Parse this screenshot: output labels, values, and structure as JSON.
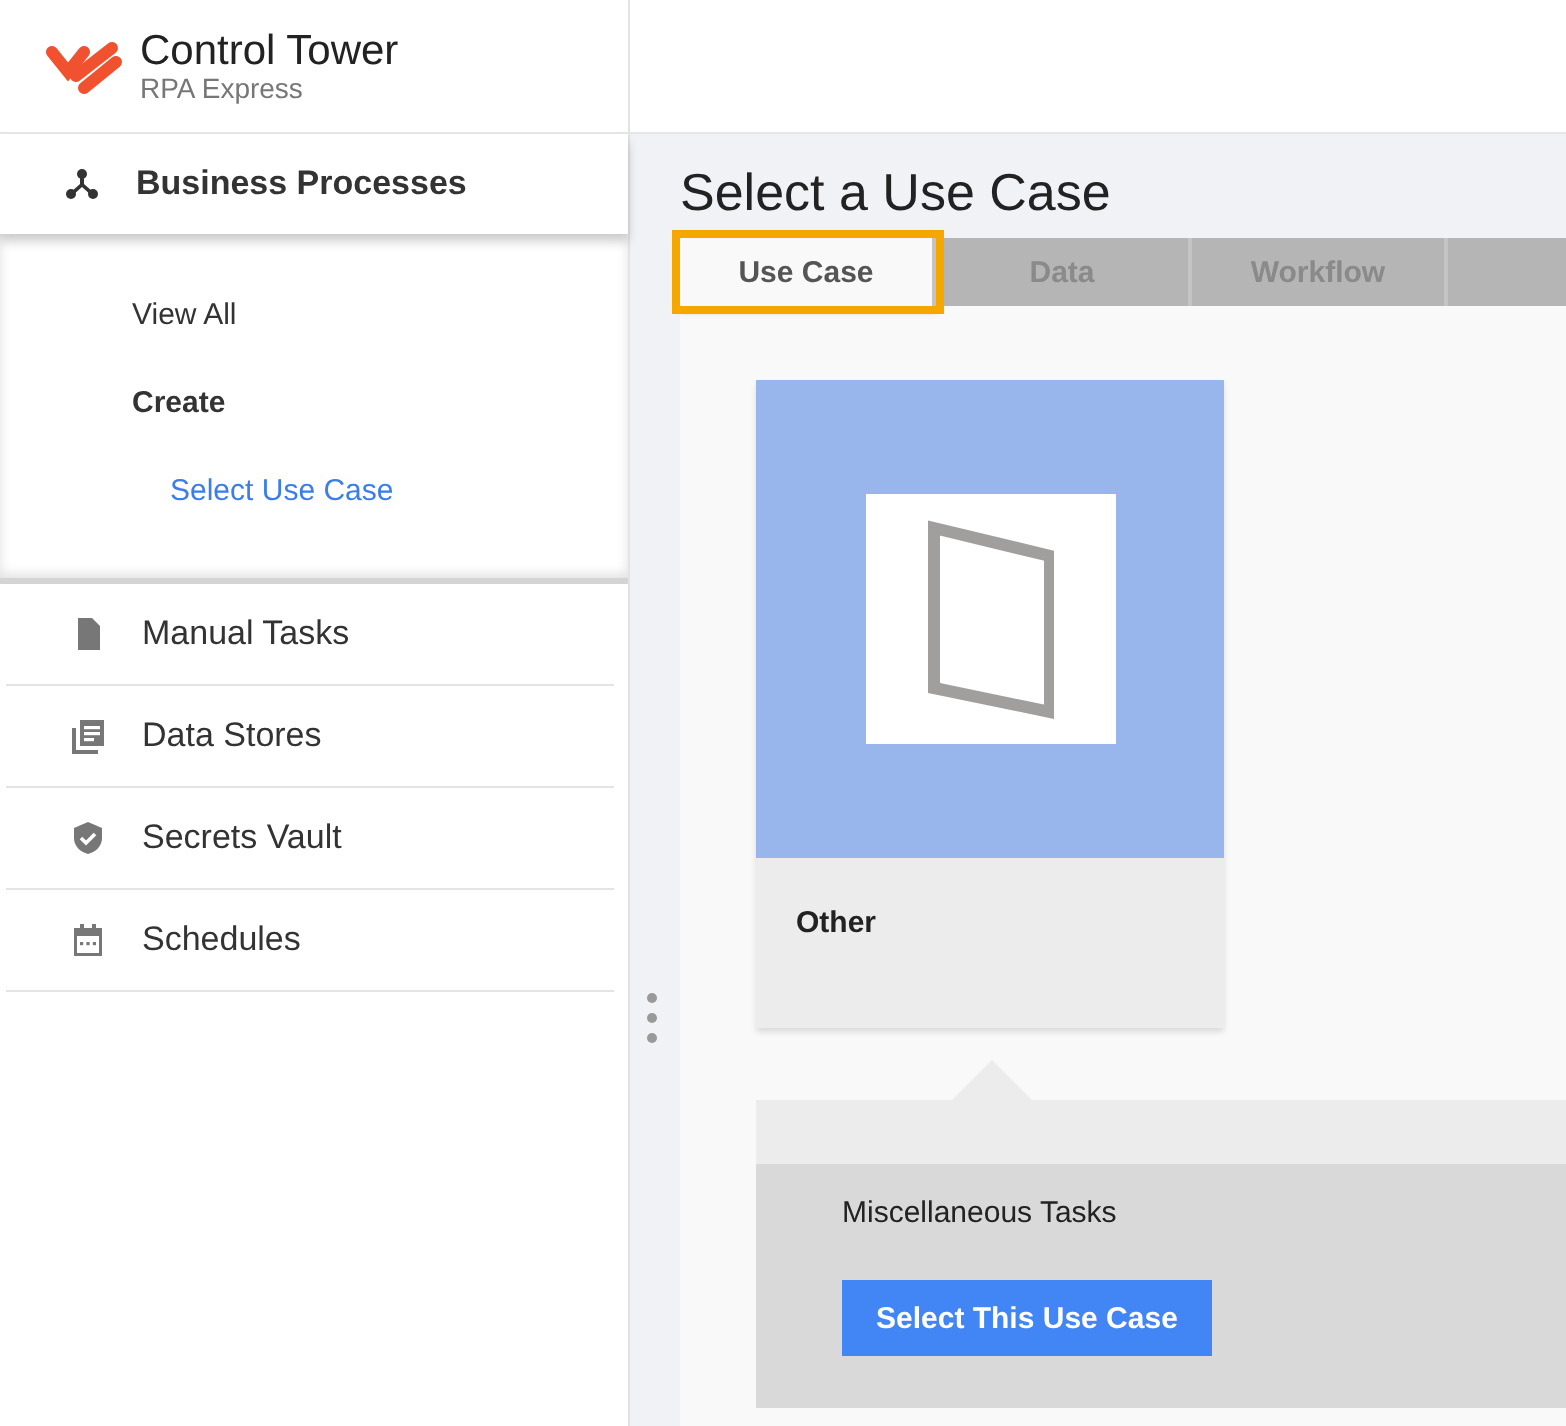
{
  "app": {
    "title": "Control Tower",
    "subtitle": "RPA Express"
  },
  "sidebar": {
    "items": [
      {
        "label": "Business Processes",
        "expanded": true,
        "children": [
          {
            "label": "View All",
            "selected": false
          },
          {
            "label": "Create",
            "selected": false,
            "children": [
              {
                "label": "Select Use Case",
                "selected": true
              }
            ]
          }
        ]
      },
      {
        "label": "Manual Tasks",
        "expanded": false
      },
      {
        "label": "Data Stores",
        "expanded": false
      },
      {
        "label": "Secrets Vault",
        "expanded": false
      },
      {
        "label": "Schedules",
        "expanded": false
      }
    ]
  },
  "page_title": "Select a Use Case",
  "tabs": [
    {
      "label": "Use Case",
      "selected": true
    },
    {
      "label": "Data",
      "selected": false
    },
    {
      "label": "Workflow",
      "selected": false
    }
  ],
  "use_cases": [
    {
      "label": "Other",
      "selected": true
    }
  ],
  "detail": {
    "title": "Miscellaneous Tasks",
    "button": "Select This Use Case"
  }
}
